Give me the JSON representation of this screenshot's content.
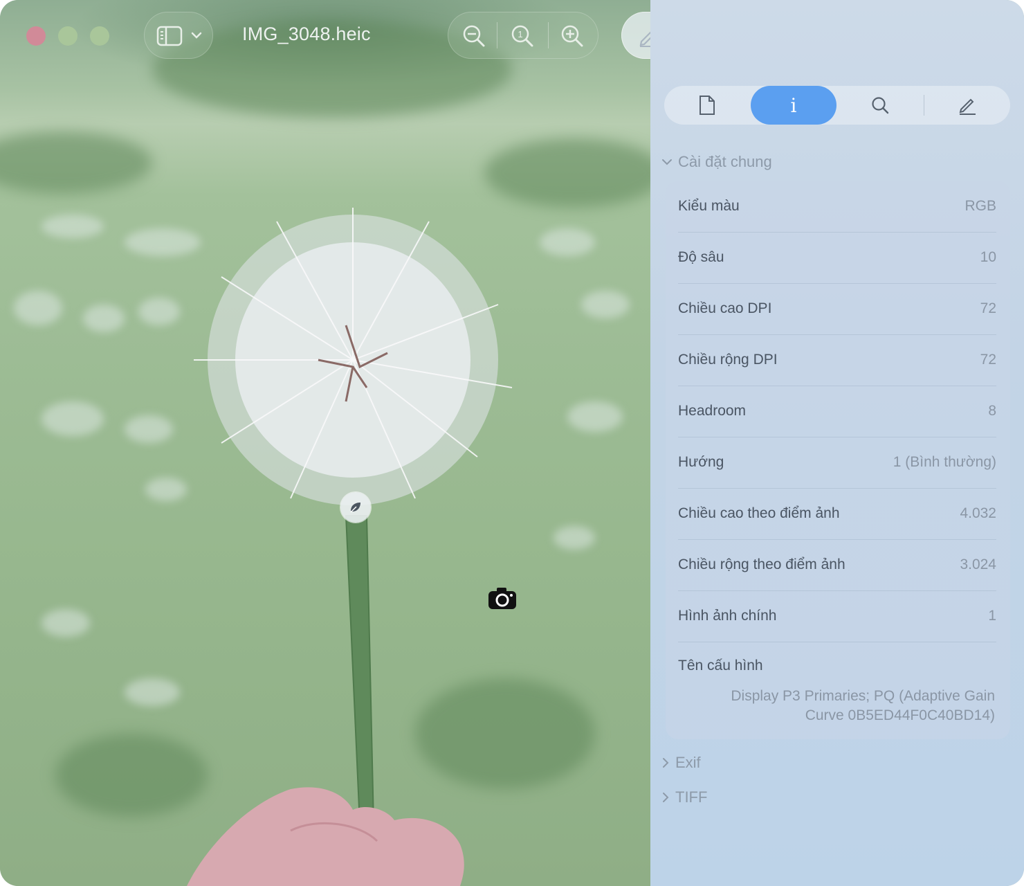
{
  "window": {
    "title": "IMG_3048.heic",
    "traffic_lights": {
      "close": "#d18a98",
      "minimize": "#a9c69a",
      "zoom": "#a9c69a"
    }
  },
  "toolbar": {
    "sidebar_toggle_icon": "sidebar-icon",
    "zoom_out_icon": "zoom-out-icon",
    "actual_size_icon": "actual-size-icon",
    "zoom_in_icon": "zoom-in-icon",
    "markup_icon": "pencil-icon",
    "crop_icon": "crop-icon",
    "rotate_icon": "rotate-icon",
    "more_icon": "chevron-double-right-icon",
    "search_icon": "search-icon"
  },
  "inspector": {
    "tabs": [
      {
        "id": "document",
        "icon": "document-icon"
      },
      {
        "id": "info",
        "label": "i",
        "active": true
      },
      {
        "id": "search",
        "icon": "search-icon"
      },
      {
        "id": "annotate",
        "icon": "pencil-icon"
      }
    ],
    "general": {
      "title": "Cài đặt chung",
      "rows": [
        {
          "label": "Kiểu màu",
          "value": "RGB"
        },
        {
          "label": "Độ sâu",
          "value": "10"
        },
        {
          "label": "Chiều cao DPI",
          "value": "72"
        },
        {
          "label": "Chiều rộng DPI",
          "value": "72"
        },
        {
          "label": "Headroom",
          "value": "8"
        },
        {
          "label": "Hướng",
          "value": "1 (Bình thường)"
        },
        {
          "label": "Chiều cao theo điểm ảnh",
          "value": "4.032"
        },
        {
          "label": "Chiều rộng theo điểm ảnh",
          "value": "3.024"
        },
        {
          "label": "Hình ảnh chính",
          "value": "1"
        }
      ],
      "profile": {
        "label": "Tên cấu hình",
        "value_line1": "Display P3 Primaries; PQ (Adaptive Gain",
        "value_line2": "Curve 0B5ED44F0C40BD14)"
      }
    },
    "collapsed_sections": [
      "Exif",
      "TIFF"
    ]
  },
  "colors": {
    "accent": "#5b9ff0",
    "sidebar_bg": "#c8d8ea"
  }
}
